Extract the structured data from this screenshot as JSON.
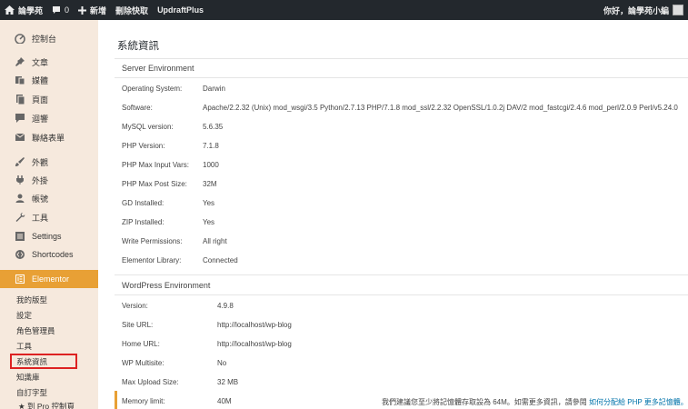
{
  "adminbar": {
    "site_name": "論學苑",
    "comments_count": "0",
    "new_label": "新增",
    "clear_cache_label": "刪除快取",
    "updraft_label": "UpdraftPlus",
    "greeting": "你好，論學苑小編"
  },
  "sidebar": {
    "items": [
      {
        "label": "控制台",
        "icon": "dashboard-icon"
      },
      {
        "label": "文章",
        "icon": "pin-icon"
      },
      {
        "label": "媒體",
        "icon": "media-icon"
      },
      {
        "label": "頁面",
        "icon": "page-icon"
      },
      {
        "label": "迴響",
        "icon": "comment-icon"
      },
      {
        "label": "聯絡表單",
        "icon": "mail-icon"
      },
      {
        "label": "外觀",
        "icon": "brush-icon"
      },
      {
        "label": "外掛",
        "icon": "plugin-icon"
      },
      {
        "label": "帳號",
        "icon": "user-icon"
      },
      {
        "label": "工具",
        "icon": "wrench-icon"
      },
      {
        "label": "Settings",
        "icon": "settings-icon"
      },
      {
        "label": "Shortcodes",
        "icon": "shortcodes-icon"
      },
      {
        "label": "Elementor",
        "icon": "elementor-icon"
      }
    ],
    "submenu": [
      "我的版型",
      "設定",
      "角色管理員",
      "工具",
      "系統資訊",
      "知識庫",
      "自訂字型",
      "到 Pro 控制頁"
    ]
  },
  "content": {
    "page_title": "系統資訊",
    "server_section": {
      "title": "Server Environment",
      "rows": [
        {
          "label": "Operating System:",
          "value": "Darwin"
        },
        {
          "label": "Software:",
          "value": "Apache/2.2.32 (Unix) mod_wsgi/3.5 Python/2.7.13 PHP/7.1.8 mod_ssl/2.2.32 OpenSSL/1.0.2j DAV/2 mod_fastcgi/2.4.6 mod_perl/2.0.9 Perl/v5.24.0"
        },
        {
          "label": "MySQL version:",
          "value": "5.6.35"
        },
        {
          "label": "PHP Version:",
          "value": "7.1.8"
        },
        {
          "label": "PHP Max Input Vars:",
          "value": "1000"
        },
        {
          "label": "PHP Max Post Size:",
          "value": "32M"
        },
        {
          "label": "GD Installed:",
          "value": "Yes"
        },
        {
          "label": "ZIP Installed:",
          "value": "Yes"
        },
        {
          "label": "Write Permissions:",
          "value": "All right"
        },
        {
          "label": "Elementor Library:",
          "value": "Connected"
        }
      ]
    },
    "wp_section": {
      "title": "WordPress Environment",
      "rows": [
        {
          "label": "Version:",
          "value": "4.9.8"
        },
        {
          "label": "Site URL:",
          "value": "http://localhost/wp-blog"
        },
        {
          "label": "Home URL:",
          "value": "http://localhost/wp-blog"
        },
        {
          "label": "WP Multisite:",
          "value": "No"
        },
        {
          "label": "Max Upload Size:",
          "value": "32 MB"
        },
        {
          "label": "Memory limit:",
          "value": "40M"
        }
      ],
      "memory_note": "我們建議您至少將記憶體存取設為 64M。如需更多資訊，請參閱",
      "memory_note_link": "如何分配給 PHP 更多記憶體。"
    }
  }
}
